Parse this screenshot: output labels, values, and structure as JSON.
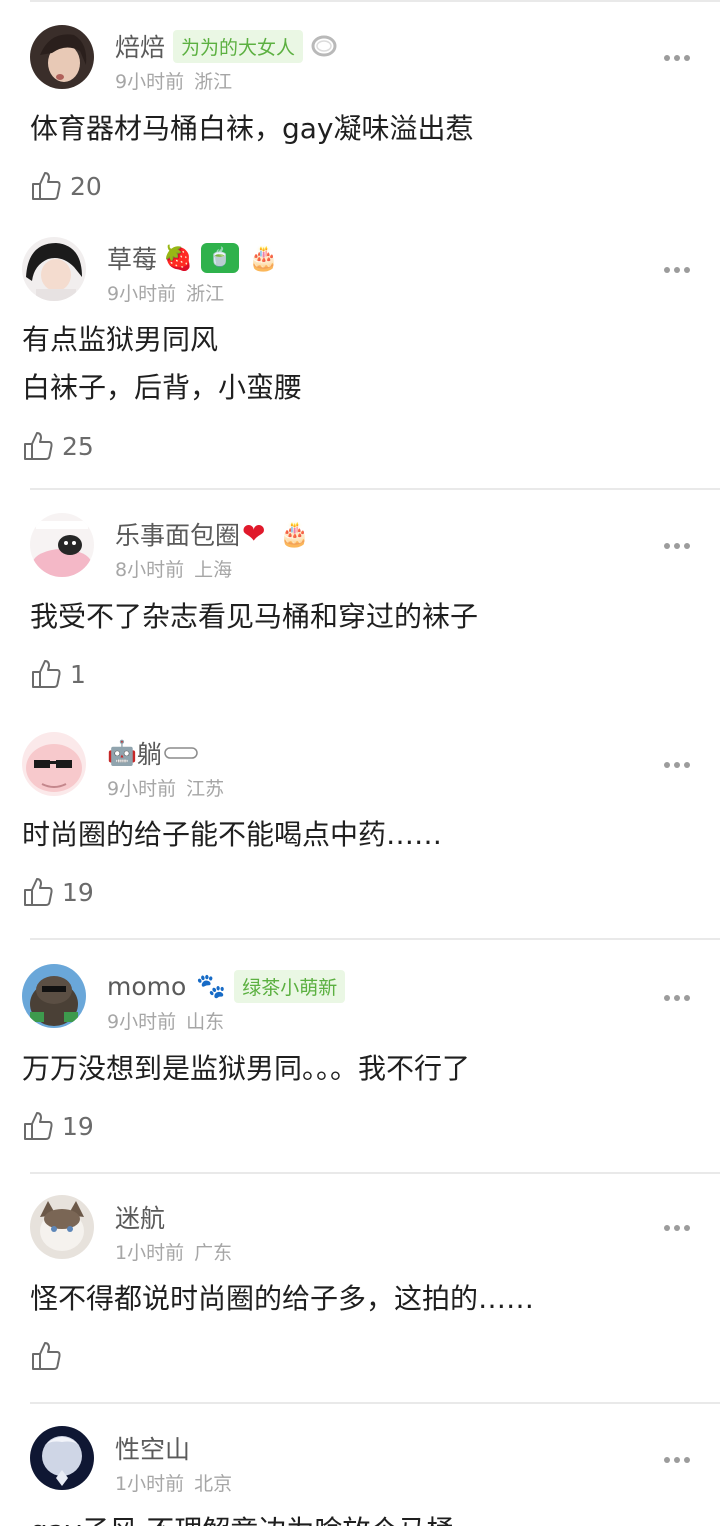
{
  "comments": [
    {
      "username": "焙焙",
      "badge": "为为的大女人",
      "badge_icon": "ring-icon",
      "time": "9小时前",
      "location": "浙江",
      "lines": [
        "体育器材马桶白袜，gay凝味溢出惹"
      ],
      "likes": "20"
    },
    {
      "username": "草莓",
      "emojis": [
        "🍓",
        "🍵",
        "🎂"
      ],
      "time": "9小时前",
      "location": "浙江",
      "lines": [
        "有点监狱男同风",
        "白袜子，后背，小蛮腰"
      ],
      "likes": "25"
    },
    {
      "username": "乐事面包圈",
      "emojis": [
        "❤",
        "🎂"
      ],
      "time": "8小时前",
      "location": "上海",
      "lines": [
        "我受不了杂志看见马桶和穿过的袜子"
      ],
      "likes": "1"
    },
    {
      "username_prefix_emoji": "🤖",
      "username": "躺",
      "time": "9小时前",
      "location": "江苏",
      "lines": [
        "时尚圈的给子能不能喝点中药……"
      ],
      "likes": "19"
    },
    {
      "username": "momo",
      "emojis": [
        "🐾"
      ],
      "badge": "绿茶小萌新",
      "time": "9小时前",
      "location": "山东",
      "lines": [
        "万万没想到是监狱男同。。。我不行了"
      ],
      "likes": "19"
    },
    {
      "username": "迷航",
      "time": "1小时前",
      "location": "广东",
      "lines": [
        "怪不得都说时尚圈的给子多，这拍的……"
      ],
      "likes": ""
    },
    {
      "username": "性空山",
      "time": "1小时前",
      "location": "北京",
      "lines": [
        "gay子风      不理解竟边为啥放个马桶"
      ],
      "likes": ""
    }
  ],
  "colors": {
    "badge_bg": "#eaf7e4",
    "badge_text": "#5cb041",
    "meta_text": "#a6a6a6"
  }
}
